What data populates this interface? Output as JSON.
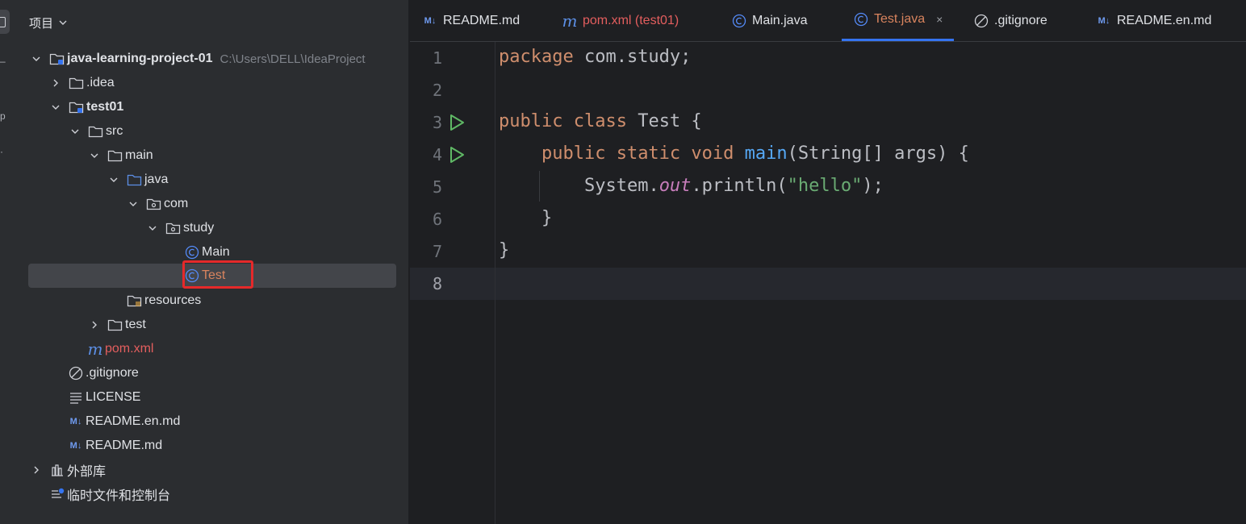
{
  "project_panel": {
    "title": "项目",
    "tree": [
      {
        "label": "java-learning-project-01",
        "hint": "C:\\Users\\DELL\\IdeaProject",
        "icon": "module-folder-icon",
        "expanded": true
      },
      {
        "label": ".idea",
        "icon": "folder-icon",
        "expanded": false
      },
      {
        "label": "test01",
        "icon": "module-folder-icon",
        "expanded": true
      },
      {
        "label": "src",
        "icon": "folder-icon",
        "expanded": true
      },
      {
        "label": "main",
        "icon": "folder-icon",
        "expanded": true
      },
      {
        "label": "java",
        "icon": "source-folder-icon",
        "expanded": true
      },
      {
        "label": "com",
        "icon": "package-icon",
        "expanded": true
      },
      {
        "label": "study",
        "icon": "package-icon",
        "expanded": true
      },
      {
        "label": "Main",
        "icon": "java-class-icon"
      },
      {
        "label": "Test",
        "icon": "java-class-icon",
        "selected": true
      },
      {
        "label": "resources",
        "icon": "resources-folder-icon"
      },
      {
        "label": "test",
        "icon": "folder-icon",
        "expanded": false
      },
      {
        "label": "pom.xml",
        "icon": "maven-icon"
      },
      {
        "label": ".gitignore",
        "icon": "ignore-icon"
      },
      {
        "label": "LICENSE",
        "icon": "text-file-icon"
      },
      {
        "label": "README.en.md",
        "icon": "markdown-icon"
      },
      {
        "label": "README.md",
        "icon": "markdown-icon"
      },
      {
        "label": "外部库",
        "icon": "library-icon",
        "expanded": false
      },
      {
        "label": "临时文件和控制台",
        "icon": "scratches-icon"
      }
    ]
  },
  "tabs": [
    {
      "label": "README.md",
      "icon": "markdown-icon"
    },
    {
      "label": "pom.xml (test01)",
      "icon": "maven-icon"
    },
    {
      "label": "Main.java",
      "icon": "java-class-icon"
    },
    {
      "label": "Test.java",
      "icon": "java-class-icon",
      "active": true,
      "close": "×"
    },
    {
      "label": ".gitignore",
      "icon": "ignore-icon"
    },
    {
      "label": "README.en.md",
      "icon": "markdown-icon"
    }
  ],
  "editor": {
    "line_numbers": [
      "1",
      "2",
      "3",
      "4",
      "5",
      "6",
      "7",
      "8"
    ],
    "current_line": "8",
    "code": {
      "l1_kw": "package",
      "l1_rest": " com.study;",
      "l3_kw": "public class",
      "l3_rest": " Test {",
      "l4_kw": "public static void",
      "l4_fn": "main",
      "l4_rest": "(String[] args) {",
      "l5_a": "System.",
      "l5_field": "out",
      "l5_b": ".println(",
      "l5_str": "\"hello\"",
      "l5_c": ");",
      "l6": "}",
      "l7": "}"
    }
  },
  "colors": {
    "accent": "#3574f0",
    "keyword": "#cf8e6d",
    "function": "#56a8f5",
    "string": "#6aab73",
    "field": "#c77dbb",
    "highlight_box": "#e5292a"
  }
}
